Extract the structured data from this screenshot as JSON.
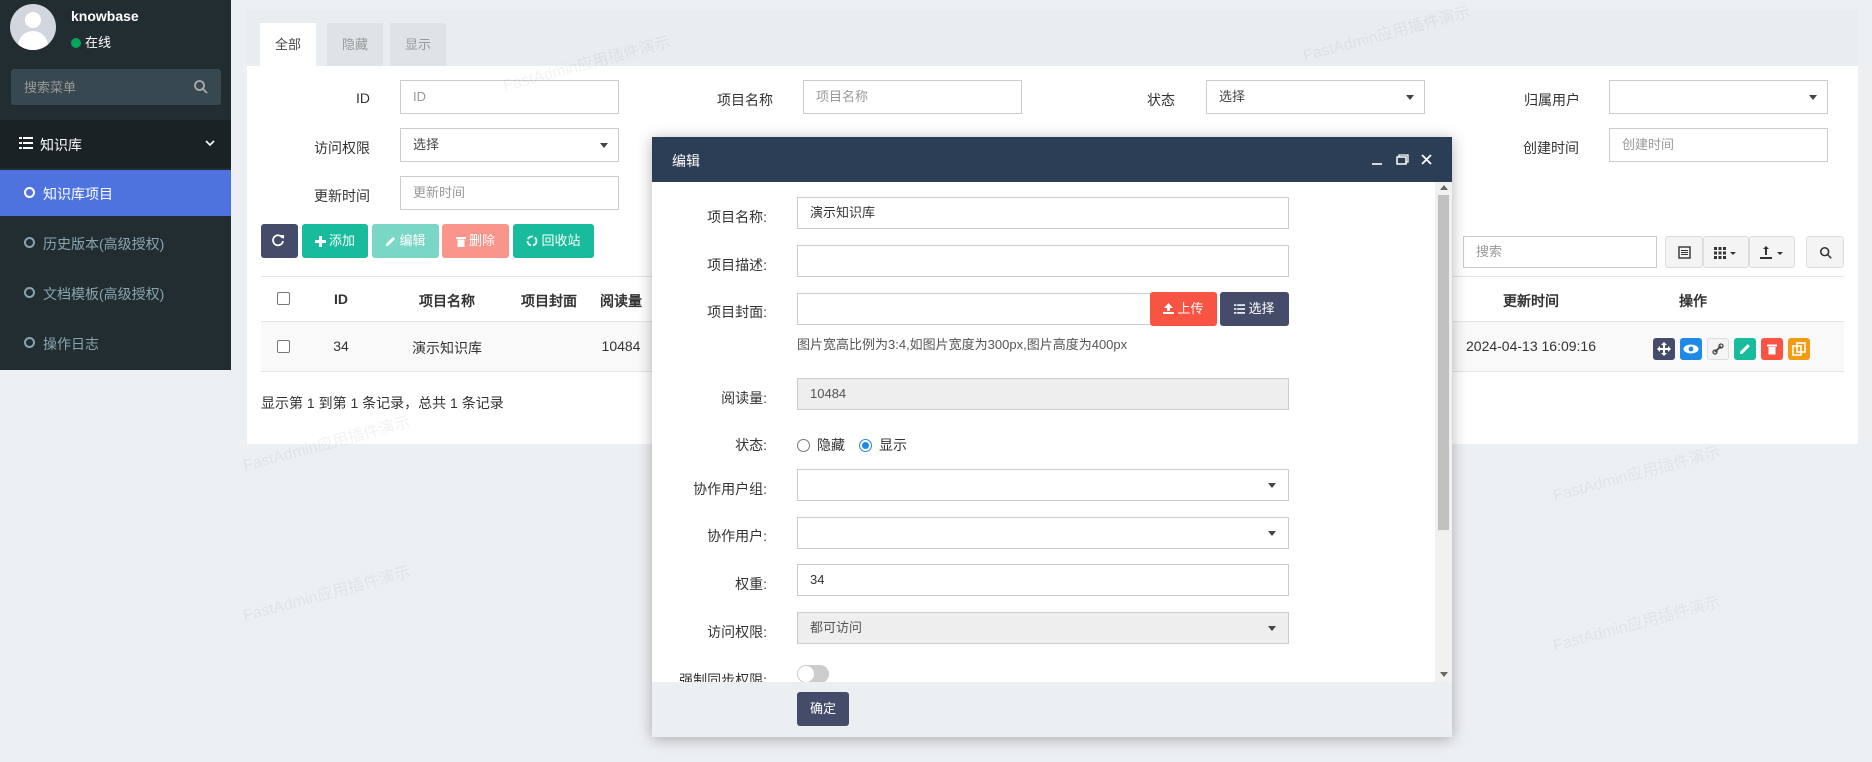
{
  "user": {
    "name": "knowbase",
    "status": "在线"
  },
  "sidebar": {
    "search_placeholder": "搜索菜单",
    "header": "知识库",
    "items": [
      {
        "label": "知识库项目",
        "active": true
      },
      {
        "label": "历史版本(高级授权)",
        "active": false
      },
      {
        "label": "文档模板(高级授权)",
        "active": false
      },
      {
        "label": "操作日志",
        "active": false
      }
    ]
  },
  "tabs": [
    "全部",
    "隐藏",
    "显示"
  ],
  "filters": {
    "id_label": "ID",
    "id_placeholder": "ID",
    "name_label": "项目名称",
    "name_placeholder": "项目名称",
    "status_label": "状态",
    "status_value": "选择",
    "owner_label": "归属用户",
    "owner_value": "",
    "access_label": "访问权限",
    "access_value": "选择",
    "created_label": "创建时间",
    "created_placeholder": "创建时间",
    "updated_label": "更新时间",
    "updated_placeholder": "更新时间"
  },
  "toolbar": {
    "add": "添加",
    "edit": "编辑",
    "delete": "删除",
    "recycle": "回收站",
    "search_placeholder": "搜索"
  },
  "table": {
    "headers": [
      "ID",
      "项目名称",
      "项目封面",
      "阅读量",
      "更新时间",
      "操作"
    ],
    "rows": [
      {
        "id": "34",
        "name": "演示知识库",
        "cover": "",
        "views": "10484",
        "updated": "2024-04-13 16:09:16"
      }
    ]
  },
  "pager": "显示第 1 到第 1 条记录，总共 1 条记录",
  "watermark": "FastAdmin应用插件演示",
  "modal": {
    "title": "编辑",
    "fields": {
      "name_label": "项目名称:",
      "name_value": "演示知识库",
      "desc_label": "项目描述:",
      "desc_value": "",
      "cover_label": "项目封面:",
      "cover_value": "",
      "upload": "上传",
      "choose": "选择",
      "hint": "图片宽高比例为3:4,如图片宽度为300px,图片高度为400px",
      "views_label": "阅读量:",
      "views_value": "10484",
      "status_label": "状态:",
      "status_hidden": "隐藏",
      "status_shown": "显示",
      "group_label": "协作用户组:",
      "group_value": "",
      "collab_label": "协作用户:",
      "collab_value": "",
      "weight_label": "权重:",
      "weight_value": "34",
      "access_label": "访问权限:",
      "access_value": "都可访问",
      "sync_label": "强制同步权限:"
    },
    "ok": "确定"
  },
  "colors": {
    "sidebar": "#222d32",
    "active": "#4e73df",
    "green": "#18bc9c",
    "red": "#f75444",
    "modal_head": "#2c3e56"
  }
}
